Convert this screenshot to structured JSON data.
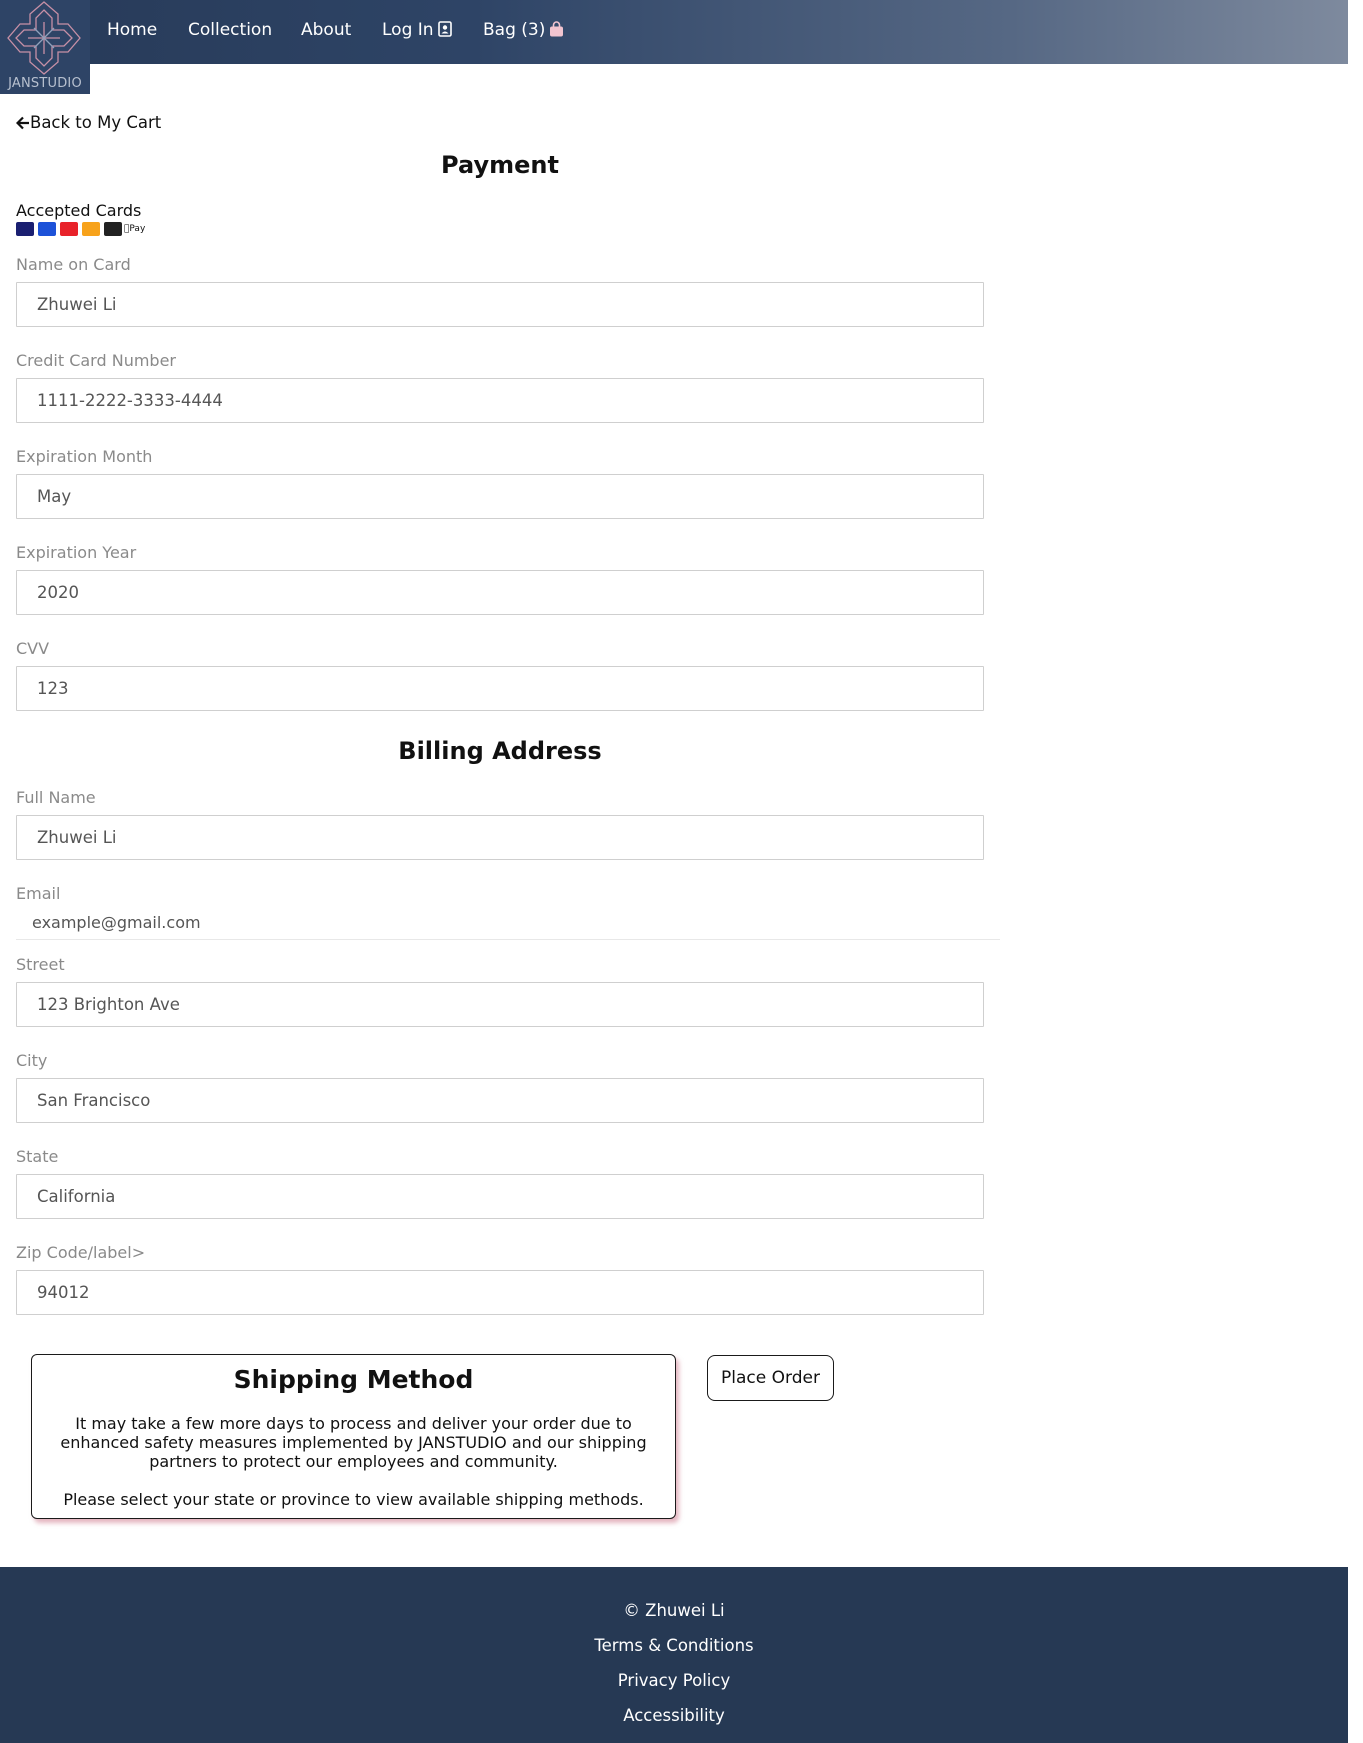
{
  "nav": {
    "logo_text": "JANSTUDIO",
    "links": [
      "Home",
      "Collection",
      "About",
      "Log In"
    ],
    "bag_label": "Bag (3)",
    "login_icon": "contact-book-icon",
    "bag_icon": "shopping-bag-icon"
  },
  "back_link": "Back to My Cart",
  "payment": {
    "title": "Payment",
    "accepted_cards_label": "Accepted Cards",
    "card_icons": [
      "visa-icon",
      "amex-icon",
      "mastercard-icon",
      "discover-icon",
      "jcb-icon",
      "apple-pay-icon"
    ],
    "apple_pay_text": "Pay",
    "fields": {
      "name_on_card": {
        "label": "Name on Card",
        "value": "Zhuwei Li"
      },
      "card_number": {
        "label": "Credit Card Number",
        "value": "1111-2222-3333-4444"
      },
      "exp_month": {
        "label": "Expiration Month",
        "value": "May"
      },
      "exp_year": {
        "label": "Expiration Year",
        "value": "2020"
      },
      "cvv": {
        "label": "CVV",
        "value": "123"
      }
    }
  },
  "billing": {
    "title": "Billing Address",
    "fields": {
      "full_name": {
        "label": "Full Name",
        "value": "Zhuwei Li"
      },
      "email": {
        "label": "Email",
        "value": "example@gmail.com"
      },
      "street": {
        "label": "Street",
        "value": "123 Brighton Ave"
      },
      "city": {
        "label": "City",
        "value": "San Francisco"
      },
      "state": {
        "label": "State",
        "value": "California"
      },
      "zip": {
        "label": "Zip Code/label>",
        "value": "94012"
      }
    }
  },
  "shipping": {
    "title": "Shipping Method",
    "paragraph1": "It may take a few more days to process and deliver your order due to enhanced safety measures implemented by JANSTUDIO and our shipping partners to protect our employees and community.",
    "paragraph2": "Please select your state or province to view available shipping methods."
  },
  "place_order": "Place Order",
  "footer": {
    "copyright": "© Zhuwei Li",
    "links": [
      "Terms & Conditions",
      "Privacy Policy",
      "Accessibility"
    ]
  },
  "colors": {
    "nav_dark": "#273a58",
    "footer": "#263954",
    "bag_icon": "#f2c4d0"
  }
}
